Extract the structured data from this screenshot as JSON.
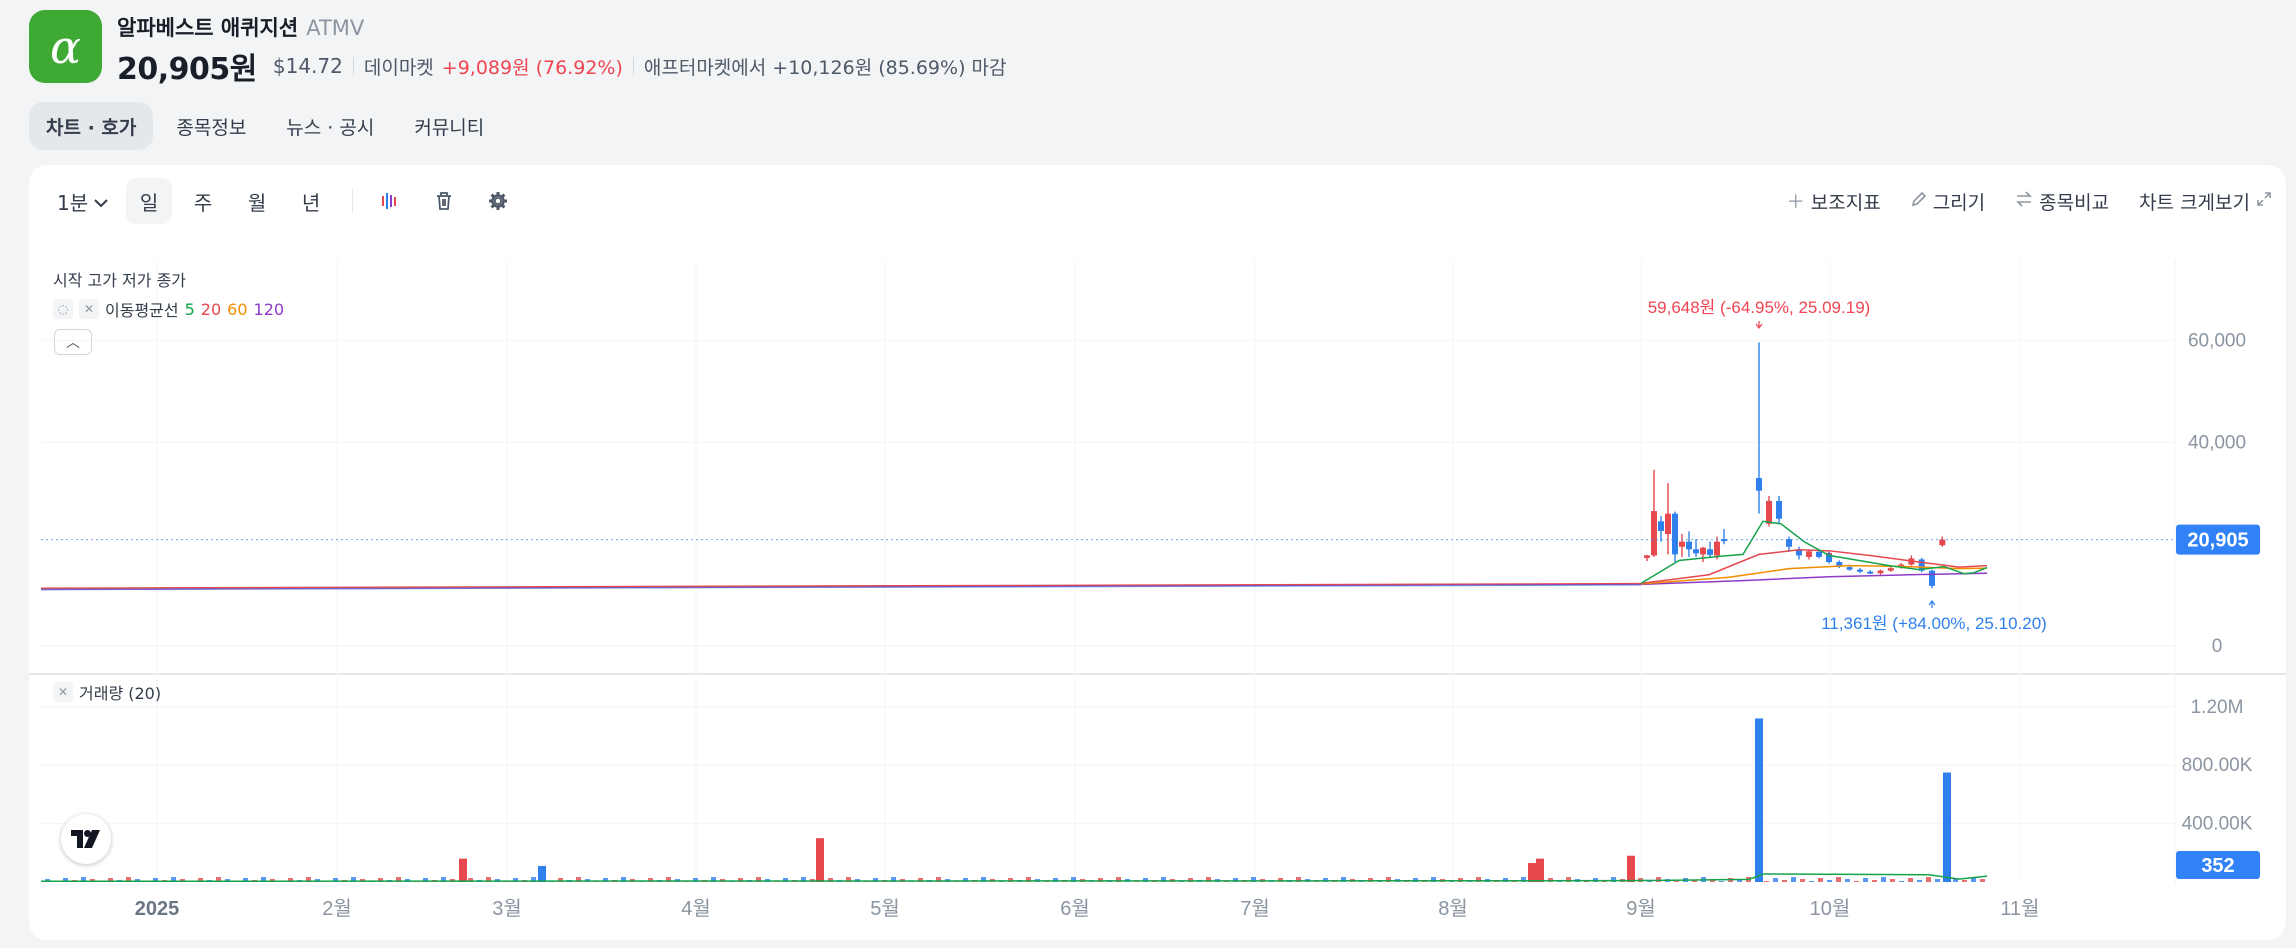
{
  "header": {
    "logo_glyph": "α",
    "name": "알파베스트 애퀴지션",
    "ticker": "ATMV",
    "price": "20,905원",
    "usd": "$14.72",
    "market_label": "데이마켓",
    "change": "+9,089원 (76.92%)",
    "after_market": "애프터마켓에서 +10,126원 (85.69%) 마감"
  },
  "tabs": [
    {
      "label": "차트 · 호가",
      "active": true
    },
    {
      "label": "종목정보",
      "active": false
    },
    {
      "label": "뉴스 · 공시",
      "active": false
    },
    {
      "label": "커뮤니티",
      "active": false
    }
  ],
  "toolbar": {
    "interval": "1분",
    "periods": [
      "일",
      "주",
      "월",
      "년"
    ],
    "active_period": "일",
    "right": [
      "보조지표",
      "그리기",
      "종목비교",
      "차트 크게보기"
    ]
  },
  "legend": {
    "ohlc": "시작 고가 저가 종가",
    "ma_label": "이동평균선",
    "ma_periods": [
      "5",
      "20",
      "60",
      "120"
    ],
    "volume_label": "거래량 (20)"
  },
  "colors": {
    "up": "#e5484d",
    "down": "#2f80ed",
    "accent": "#3182f6",
    "brand": "#3eaa34"
  },
  "chart_data": {
    "type": "candlestick",
    "price_axis": {
      "ticks": [
        "60,000",
        "40,000",
        "0"
      ],
      "ylim": [
        0,
        69000
      ]
    },
    "volume_axis": {
      "ticks": [
        "1.20M",
        "800.00K",
        "400.00K"
      ],
      "ylim": [
        0,
        1380000
      ]
    },
    "x_ticks": [
      "2025",
      "2월",
      "3월",
      "4월",
      "5월",
      "6월",
      "7월",
      "8월",
      "9월",
      "10월",
      "11월"
    ],
    "current_price_label": "20,905",
    "current_volume_label": "352",
    "high_annotation": "59,648원 (-64.95%, 25.09.19)",
    "low_annotation": "11,361원 (+84.00%, 25.10.20)",
    "candles_recent": [
      {
        "date": "25.09.01",
        "o": 17300,
        "h": 17900,
        "l": 16700,
        "c": 17800
      },
      {
        "date": "25.09.04",
        "o": 17800,
        "h": 34600,
        "l": 17500,
        "c": 26500
      },
      {
        "date": "25.09.05",
        "o": 24500,
        "h": 25500,
        "l": 20500,
        "c": 22600
      },
      {
        "date": "25.09.08",
        "o": 22000,
        "h": 32000,
        "l": 18000,
        "c": 26000
      },
      {
        "date": "25.09.09",
        "o": 26000,
        "h": 26400,
        "l": 16500,
        "c": 18000
      },
      {
        "date": "25.09.10",
        "o": 19500,
        "h": 22000,
        "l": 17500,
        "c": 20500
      },
      {
        "date": "25.09.11",
        "o": 20500,
        "h": 22500,
        "l": 17500,
        "c": 19000
      },
      {
        "date": "25.09.12",
        "o": 19000,
        "h": 21000,
        "l": 17500,
        "c": 18200
      },
      {
        "date": "25.09.15",
        "o": 18000,
        "h": 19500,
        "l": 16500,
        "c": 19300
      },
      {
        "date": "25.09.16",
        "o": 19000,
        "h": 20500,
        "l": 17500,
        "c": 17900
      },
      {
        "date": "25.09.17",
        "o": 17800,
        "h": 21500,
        "l": 17000,
        "c": 20500
      },
      {
        "date": "25.09.18",
        "o": 21000,
        "h": 23000,
        "l": 20000,
        "c": 20800
      },
      {
        "date": "25.09.19",
        "o": 33000,
        "h": 59648,
        "l": 26000,
        "c": 30500
      },
      {
        "date": "25.09.22",
        "o": 24000,
        "h": 29500,
        "l": 23500,
        "c": 28500
      },
      {
        "date": "25.09.23",
        "o": 28500,
        "h": 29500,
        "l": 24000,
        "c": 25000
      },
      {
        "date": "25.09.24",
        "o": 21000,
        "h": 21500,
        "l": 18500,
        "c": 19500
      },
      {
        "date": "25.09.25",
        "o": 19000,
        "h": 19500,
        "l": 17000,
        "c": 17800
      },
      {
        "date": "25.09.26",
        "o": 17500,
        "h": 19000,
        "l": 17000,
        "c": 18600
      },
      {
        "date": "25.09.29",
        "o": 18500,
        "h": 19000,
        "l": 17200,
        "c": 17500
      },
      {
        "date": "25.10.01",
        "o": 17800,
        "h": 18500,
        "l": 17500,
        "c": 18300
      },
      {
        "date": "25.10.02",
        "o": 18000,
        "h": 18500,
        "l": 16200,
        "c": 16500
      },
      {
        "date": "25.10.06",
        "o": 16500,
        "h": 16800,
        "l": 15300,
        "c": 15600
      },
      {
        "date": "25.10.07",
        "o": 15500,
        "h": 15800,
        "l": 14800,
        "c": 15000
      },
      {
        "date": "25.10.08",
        "o": 15000,
        "h": 15300,
        "l": 14300,
        "c": 14600
      },
      {
        "date": "25.10.09",
        "o": 14600,
        "h": 14900,
        "l": 14100,
        "c": 14300
      },
      {
        "date": "25.10.10",
        "o": 14300,
        "h": 15000,
        "l": 14000,
        "c": 14800
      },
      {
        "date": "25.10.13",
        "o": 14800,
        "h": 15500,
        "l": 14600,
        "c": 15300
      },
      {
        "date": "25.10.14",
        "o": 15500,
        "h": 16300,
        "l": 15200,
        "c": 16000
      },
      {
        "date": "25.10.15",
        "o": 16000,
        "h": 17800,
        "l": 15800,
        "c": 17200
      },
      {
        "date": "25.10.16",
        "o": 17000,
        "h": 17300,
        "l": 14500,
        "c": 14800
      },
      {
        "date": "25.10.20",
        "o": 14800,
        "h": 15000,
        "l": 11361,
        "c": 11816
      },
      {
        "date": "25.10.21",
        "o": 19800,
        "h": 21500,
        "l": 19500,
        "c": 20905
      }
    ],
    "volume_notable": [
      {
        "date": "25.02.25",
        "value": 160000
      },
      {
        "date": "25.03.06",
        "value": 110000
      },
      {
        "date": "25.04.21",
        "value": 300000
      },
      {
        "date": "25.08.25",
        "value": 130000
      },
      {
        "date": "25.08.26",
        "value": 160000
      },
      {
        "date": "25.09.01",
        "value": 180000
      },
      {
        "date": "25.09.19",
        "value": 1120000
      },
      {
        "date": "25.10.20",
        "value": 750000
      }
    ]
  }
}
